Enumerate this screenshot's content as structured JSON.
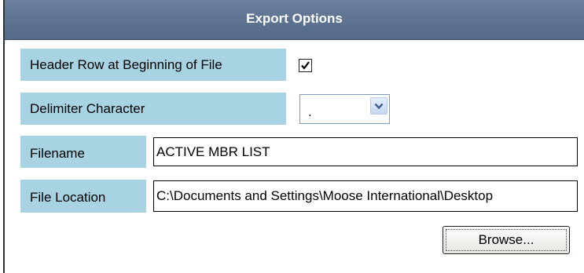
{
  "header": {
    "title": "Export Options"
  },
  "options": {
    "header_row": {
      "label": "Header Row at Beginning of File",
      "checked": true
    },
    "delimiter": {
      "label": "Delimiter Character",
      "value": "."
    },
    "filename": {
      "label": "Filename",
      "value": "ACTIVE MBR LIST"
    },
    "file_location": {
      "label": "File Location",
      "value": "C:\\Documents and Settings\\Moose International\\Desktop"
    }
  },
  "actions": {
    "browse_label": "Browse..."
  },
  "icons": {
    "checkbox": "checkmark-icon",
    "dropdown": "chevron-down-icon"
  },
  "colors": {
    "header_bg": "#5d7291",
    "label_bg": "#a8d3e3",
    "dropdown_btn": "#c4d7f5"
  }
}
